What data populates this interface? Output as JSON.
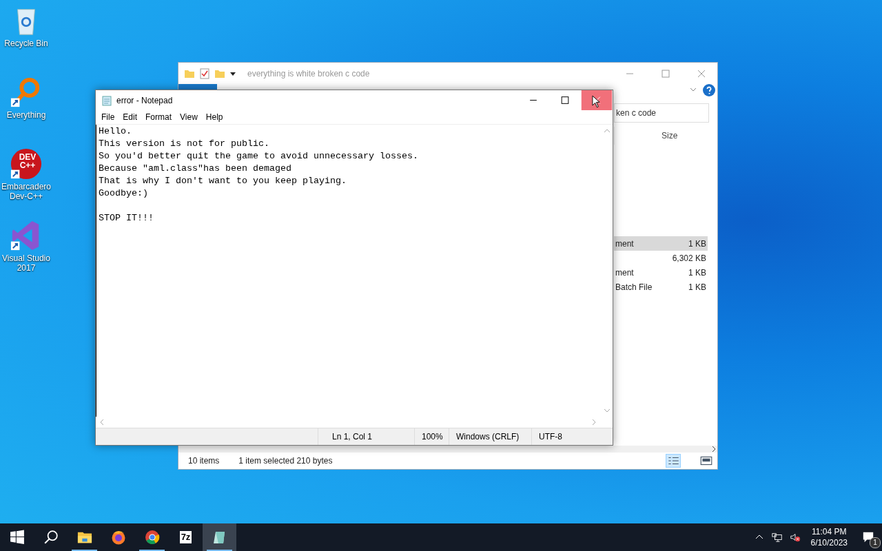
{
  "desktop_icons": [
    {
      "kind": "recycle",
      "label": "Recycle Bin",
      "shortcut": false
    },
    {
      "kind": "everything",
      "label": "Everything",
      "shortcut": true
    },
    {
      "kind": "devcpp",
      "label": "Embarcadero Dev-C++",
      "shortcut": true,
      "logo_text": "DEV C++"
    },
    {
      "kind": "vs",
      "label": "Visual Studio 2017",
      "shortcut": true
    }
  ],
  "explorer": {
    "title": "everything is white broken c code",
    "search_value": "ken c code",
    "columns": [
      "Size"
    ],
    "rows": [
      {
        "type": "ment",
        "size": "1 KB",
        "selected": true
      },
      {
        "size": "6,302 KB",
        "selected": false
      },
      {
        "type": "ment",
        "size": "1 KB",
        "selected": false
      },
      {
        "type": "Batch File",
        "size": "1 KB",
        "selected": false
      }
    ],
    "status_bar": {
      "items": "10 items",
      "selection": "1 item selected  210 bytes"
    }
  },
  "notepad": {
    "title": "error - Notepad",
    "menu": [
      "File",
      "Edit",
      "Format",
      "View",
      "Help"
    ],
    "text": "Hello.\nThis version is not for public.\nSo you'd better quit the game to avoid unnecessary losses.\nBecause \"aml.class\"has been demaged\nThat is why I don't want to you keep playing.\nGoodbye:)\n\nSTOP IT!!!",
    "close_hovered": true,
    "status_bar": [
      "Ln 1, Col 1",
      "100%",
      "Windows (CRLF)",
      "UTF-8"
    ]
  },
  "taskbar": {
    "items": [
      {
        "kind": "start",
        "running": false,
        "active": false
      },
      {
        "kind": "search",
        "running": false,
        "active": false
      },
      {
        "kind": "explorer",
        "running": true,
        "active": false
      },
      {
        "kind": "firefox",
        "running": false,
        "active": false
      },
      {
        "kind": "chrome",
        "running": true,
        "active": false
      },
      {
        "kind": "sevenzip",
        "label": "7z",
        "running": false,
        "active": false
      },
      {
        "kind": "notepad",
        "running": true,
        "active": true
      }
    ],
    "time": "11:04 PM",
    "date": "6/10/2023",
    "notification_count": "1",
    "volume_muted": true
  }
}
